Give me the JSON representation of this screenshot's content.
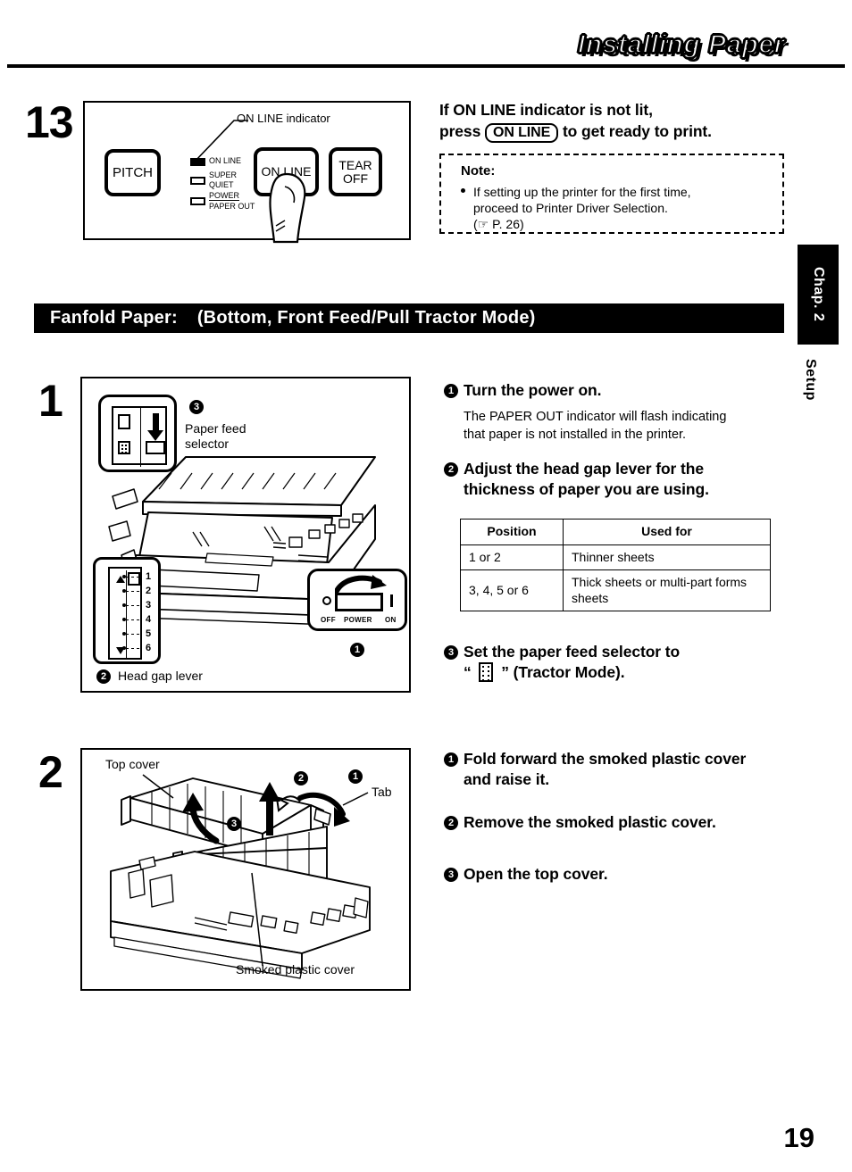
{
  "header": {
    "title": "Installing Paper"
  },
  "chapter_tab": {
    "chapter": "Chap. 2",
    "section": "Setup"
  },
  "page_number": "19",
  "step13": {
    "number": "13",
    "figure": {
      "callout": "ON LINE indicator",
      "buttons": [
        {
          "label": "PITCH"
        },
        {
          "label": "ON LINE"
        },
        {
          "label": "TEAR\nOFF"
        }
      ],
      "indicators": [
        {
          "label": "ON LINE",
          "lit": true
        },
        {
          "label_line1": "SUPER",
          "label_line2": "QUIET",
          "lit": false
        },
        {
          "label_line1": "POWER",
          "label_line2": "PAPER OUT",
          "lit": false
        }
      ]
    },
    "heading_line1": "If ON LINE indicator is not lit,",
    "heading_press": "press",
    "heading_key": "ON LINE",
    "heading_tail": "to get ready to print.",
    "note": {
      "title": "Note:",
      "bullet_line1": "If setting up the printer for the first time,",
      "bullet_line2": "proceed to Printer Driver Selection.",
      "bullet_line3": "(☞  P. 26)"
    }
  },
  "section_bar": {
    "label": "Fanfold Paper:",
    "mode": "(Bottom, Front Feed/Pull Tractor Mode)"
  },
  "step1": {
    "number": "1",
    "figure": {
      "paper_feed_selector_label": "Paper  feed\nselector",
      "paper_feed_selector_marker": "3",
      "head_gap_lever_label": "Head gap lever",
      "head_gap_lever_marker": "2",
      "head_gap_positions": [
        "1",
        "2",
        "3",
        "4",
        "5",
        "6"
      ],
      "power_switch_marker": "1",
      "power_off_label": "OFF",
      "power_label": "POWER",
      "power_on_label": "ON"
    },
    "items": [
      {
        "marker": "1",
        "heading": "Turn the power on.",
        "body_line1": "The PAPER OUT indicator will flash indicating",
        "body_line2": "that paper is not installed in the printer."
      },
      {
        "marker": "2",
        "heading_line1": "Adjust the head gap lever for the",
        "heading_line2": "thickness of paper you are using."
      },
      {
        "marker": "3",
        "heading_line1": "Set the paper feed selector to",
        "heading_quote_open": "“",
        "heading_quote_close": "”",
        "heading_line2_tail": "(Tractor Mode)."
      }
    ],
    "table": {
      "headers": [
        "Position",
        "Used for"
      ],
      "rows": [
        [
          "1 or 2",
          "Thinner sheets"
        ],
        [
          "3, 4, 5 or 6",
          "Thick sheets or multi-part forms sheets"
        ]
      ]
    }
  },
  "step2": {
    "number": "2",
    "figure": {
      "top_cover_label": "Top cover",
      "tab_label": "Tab",
      "smoked_cover_label": "Smoked plastic cover",
      "markers": [
        "1",
        "2",
        "3"
      ]
    },
    "items": [
      {
        "marker": "1",
        "heading_line1": "Fold forward the smoked plastic cover",
        "heading_line2": "and raise it."
      },
      {
        "marker": "2",
        "heading_line1": "Remove the smoked plastic cover."
      },
      {
        "marker": "3",
        "heading_line1": "Open the top cover."
      }
    ]
  }
}
